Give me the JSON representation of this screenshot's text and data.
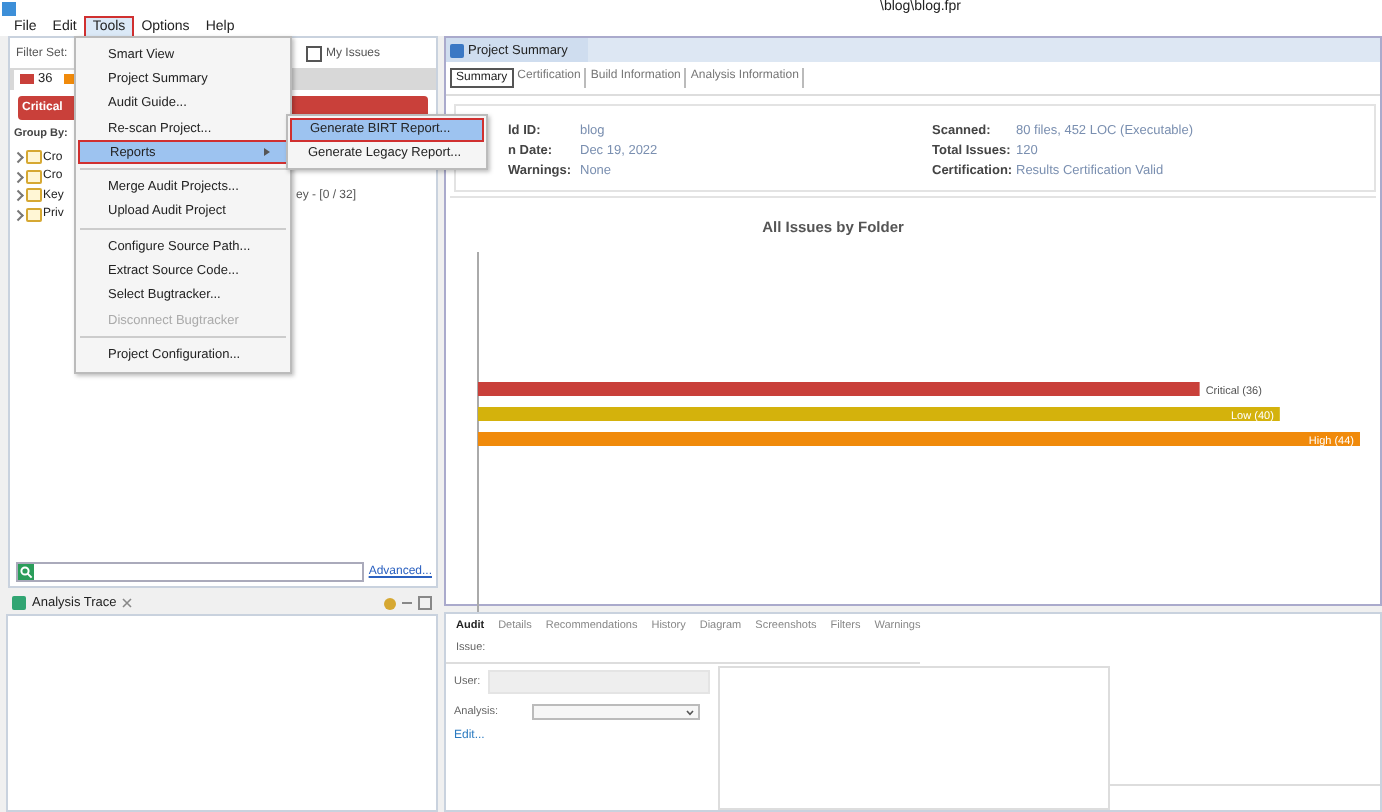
{
  "window": {
    "title": "\\blog\\blog.fpr"
  },
  "menu_bar": [
    {
      "label": "File",
      "selected": false
    },
    {
      "label": "Edit",
      "selected": false
    },
    {
      "label": "Tools",
      "selected": true
    },
    {
      "label": "Options",
      "selected": false
    },
    {
      "label": "Help",
      "selected": false
    }
  ],
  "tools_menu": [
    {
      "kind": "item",
      "label": "Smart View",
      "selected": false,
      "disabled": false
    },
    {
      "kind": "item",
      "label": "Project Summary",
      "selected": false,
      "disabled": false
    },
    {
      "kind": "item",
      "label": "Audit Guide...",
      "selected": false,
      "disabled": false
    },
    {
      "kind": "item",
      "label": "Re-scan Project...",
      "selected": false,
      "disabled": false
    },
    {
      "kind": "submenu",
      "label": "Reports",
      "selected": true,
      "disabled": false
    },
    {
      "kind": "separator"
    },
    {
      "kind": "item",
      "label": "Merge Audit Projects...",
      "selected": false,
      "disabled": false
    },
    {
      "kind": "item",
      "label": "Upload Audit Project",
      "selected": false,
      "disabled": false
    },
    {
      "kind": "separator"
    },
    {
      "kind": "item",
      "label": "Configure Source Path...",
      "selected": false,
      "disabled": false
    },
    {
      "kind": "item",
      "label": "Extract Source Code...",
      "selected": false,
      "disabled": false
    },
    {
      "kind": "item",
      "label": "Select Bugtracker...",
      "selected": false,
      "disabled": false
    },
    {
      "kind": "item",
      "label": "Disconnect Bugtracker",
      "selected": false,
      "disabled": true
    },
    {
      "kind": "separator"
    },
    {
      "kind": "item",
      "label": "Project Configuration...",
      "selected": false,
      "disabled": false
    }
  ],
  "reports_submenu": [
    {
      "label": "Generate BIRT Report...",
      "selected": true
    },
    {
      "label": "Generate Legacy Report...",
      "selected": false
    }
  ],
  "issues_view": {
    "filter_set_label": "Filter Set:",
    "my_issues": {
      "label": "My Issues",
      "checked": false
    },
    "folder_tabs": [
      {
        "count": "36",
        "color": "#c9403a"
      },
      {
        "color": "#f08a0b"
      }
    ],
    "critical_bar": "Critical",
    "group_by_label": "Group By:",
    "tree": [
      {
        "label": "Cro",
        "expanded": false
      },
      {
        "label": "Cro",
        "expanded": false
      },
      {
        "label": "Key",
        "expanded": false
      },
      {
        "label": "Priv",
        "expanded": false
      }
    ],
    "tree_fragment": "ey - [0 / 32]",
    "advanced_link": "Advanced..."
  },
  "analysis_trace": {
    "title": "Analysis Trace"
  },
  "project_summary": {
    "title": "Project Summary",
    "tabs": [
      {
        "label": "Summary",
        "selected": true
      },
      {
        "label": "Certification",
        "selected": false
      },
      {
        "label": "Build Information",
        "selected": false
      },
      {
        "label": "Analysis Information",
        "selected": false
      }
    ],
    "fields_left": [
      {
        "label": "ld ID:",
        "value": "blog"
      },
      {
        "label": "n Date:",
        "value": "Dec 19, 2022"
      },
      {
        "label": "Warnings:",
        "value": "None"
      }
    ],
    "fields_right": [
      {
        "label": "Scanned:",
        "value": "80 files, 452 LOC (Executable)"
      },
      {
        "label": "Total Issues:",
        "value": "120"
      },
      {
        "label": "Certification:",
        "value": "Results Certification Valid"
      }
    ],
    "chart_data": {
      "type": "bar",
      "orientation": "horizontal",
      "title": "All Issues by Folder",
      "values": [
        36,
        40,
        44
      ],
      "colors": [
        "#c9403a",
        "#d4b20c",
        "#f08a0b"
      ],
      "value_labels": [
        "Critical (36)",
        "Low (40)",
        "High (44)"
      ],
      "xlim": [
        0,
        44
      ]
    }
  },
  "audit_panel": {
    "tabs": [
      {
        "label": "Audit",
        "selected": true
      },
      {
        "label": "Details",
        "selected": false
      },
      {
        "label": "Recommendations",
        "selected": false
      },
      {
        "label": "History",
        "selected": false
      },
      {
        "label": "Diagram",
        "selected": false
      },
      {
        "label": "Screenshots",
        "selected": false
      },
      {
        "label": "Filters",
        "selected": false
      },
      {
        "label": "Warnings",
        "selected": false
      }
    ],
    "issue_label": "Issue:",
    "user_label": "User:",
    "analysis_label": "Analysis:",
    "edit_link": "Edit..."
  }
}
